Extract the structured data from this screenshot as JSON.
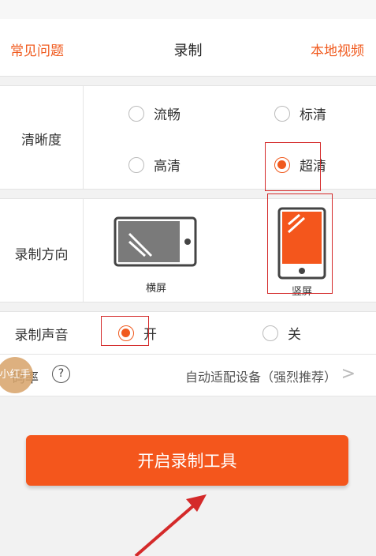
{
  "nav": {
    "left": "常见问题",
    "title": "录制",
    "right": "本地视频"
  },
  "resolution": {
    "label": "清晰度",
    "options": [
      {
        "label": "流畅",
        "selected": false
      },
      {
        "label": "标清",
        "selected": false
      },
      {
        "label": "高清",
        "selected": false
      },
      {
        "label": "超清",
        "selected": true
      }
    ]
  },
  "orientation": {
    "label": "录制方向",
    "options": [
      {
        "label": "横屏",
        "selected": false
      },
      {
        "label": "竖屏",
        "selected": true
      }
    ]
  },
  "sound": {
    "label": "录制声音",
    "options": [
      {
        "label": "开",
        "selected": true
      },
      {
        "label": "关",
        "selected": false
      }
    ]
  },
  "rate": {
    "label": "码率",
    "help_icon": "?",
    "value": "自动适配设备（强烈推荐）",
    "chevron": ">"
  },
  "overlay": {
    "text": "小红手"
  },
  "start_button": {
    "label": "开启录制工具"
  },
  "colors": {
    "accent": "#f05a1e",
    "button": "#f4561c",
    "annotation": "#d42a2a"
  }
}
